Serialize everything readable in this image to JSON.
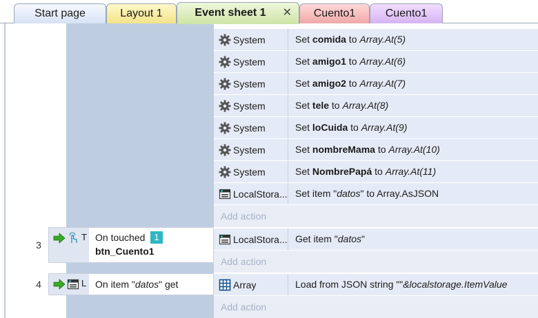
{
  "tabs": [
    {
      "label": "Start page"
    },
    {
      "label": "Layout 1"
    },
    {
      "label": "Event sheet 1",
      "close": "✕"
    },
    {
      "label": "Cuento1"
    },
    {
      "label": "Cuento1"
    }
  ],
  "event_block": {
    "actions": [
      {
        "object": "System",
        "prefix": "Set ",
        "var": "comida",
        "mid": " to ",
        "expr": "Array.At(5)"
      },
      {
        "object": "System",
        "prefix": "Set ",
        "var": "amigo1",
        "mid": " to ",
        "expr": "Array.At(6)"
      },
      {
        "object": "System",
        "prefix": "Set ",
        "var": "amigo2",
        "mid": " to ",
        "expr": "Array.At(7)"
      },
      {
        "object": "System",
        "prefix": "Set ",
        "var": "tele",
        "mid": " to ",
        "expr": "Array.At(8)"
      },
      {
        "object": "System",
        "prefix": "Set ",
        "var": "loCuida",
        "mid": " to ",
        "expr": "Array.At(9)"
      },
      {
        "object": "System",
        "prefix": "Set ",
        "var": "nombreMama",
        "mid": " to ",
        "expr": "Array.At(10)"
      },
      {
        "object": "System",
        "prefix": "Set ",
        "var": "NombrePapá",
        "mid": " to ",
        "expr": "Array.At(11)"
      },
      {
        "object": "LocalStora...",
        "prefix": "Set item \"",
        "key": "datos",
        "suffix": "\" to Array.AsJSON"
      }
    ],
    "add_action": "Add action"
  },
  "event3": {
    "number": "3",
    "trigger_letter": "T",
    "condition_label": "On touched",
    "badge": "1",
    "object": "btn_Cuento1",
    "action_object": "LocalStora...",
    "action_prefix": "Get item \"",
    "action_key": "datos",
    "action_suffix": "\"",
    "add_action": "Add action"
  },
  "event4": {
    "number": "4",
    "trigger_letter": "L",
    "condition_prefix": "On item \"",
    "condition_key": "datos",
    "condition_suffix": "\" get",
    "action_object": "Array",
    "action_text": "Load from JSON string \"\"",
    "action_expr": "&localstorage.ItemValue",
    "add_action": "Add action"
  },
  "colors": {
    "accent_badge": "#2fb6c2",
    "arrow_green": "#3aa828",
    "event_tab": "#cfe5a8"
  },
  "icons": {
    "system": "gear-icon",
    "localstorage": "localstorage-icon",
    "array": "array-grid-icon",
    "trigger_arrow": "green-arrow-icon",
    "touch": "touch-hand-icon"
  }
}
